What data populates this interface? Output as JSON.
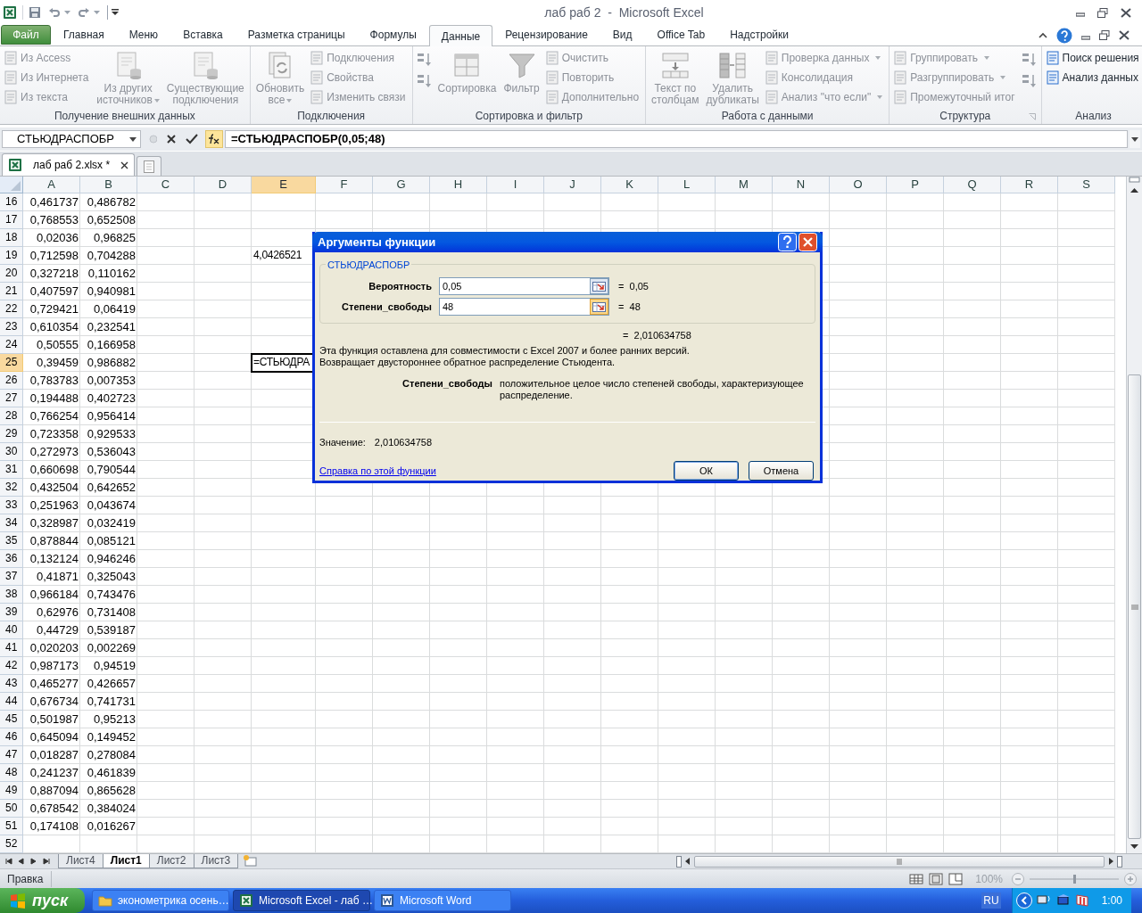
{
  "title_bar": {
    "title": "лаб раб 2  -  Microsoft Excel"
  },
  "file_tab": "Файл",
  "ribbon_tabs": [
    {
      "label": "Главная",
      "selected": false
    },
    {
      "label": "Меню",
      "selected": false
    },
    {
      "label": "Вставка",
      "selected": false
    },
    {
      "label": "Разметка страницы",
      "selected": false
    },
    {
      "label": "Формулы",
      "selected": false
    },
    {
      "label": "Данные",
      "selected": true
    },
    {
      "label": "Рецензирование",
      "selected": false
    },
    {
      "label": "Вид",
      "selected": false
    },
    {
      "label": "Office Tab",
      "selected": false
    },
    {
      "label": "Надстройки",
      "selected": false
    }
  ],
  "ribbon_groups": [
    {
      "label": "Получение внешних данных",
      "columns": [
        {
          "kind": "stack",
          "items": [
            {
              "label": "Из Access",
              "disabled": true,
              "dropdown": false
            },
            {
              "label": "Из Интернета",
              "disabled": true,
              "dropdown": false
            },
            {
              "label": "Из текста",
              "disabled": true,
              "dropdown": false
            }
          ]
        },
        {
          "kind": "large",
          "items": [
            {
              "lines": [
                "Из других",
                "источников"
              ],
              "disabled": true,
              "dropdown": true
            }
          ]
        },
        {
          "kind": "large",
          "items": [
            {
              "lines": [
                "Существующие",
                "подключения"
              ],
              "disabled": true,
              "dropdown": false
            }
          ]
        }
      ]
    },
    {
      "label": "Подключения",
      "columns": [
        {
          "kind": "large",
          "items": [
            {
              "lines": [
                "Обновить",
                "все"
              ],
              "disabled": true,
              "dropdown": true
            }
          ]
        },
        {
          "kind": "stack",
          "items": [
            {
              "label": "Подключения",
              "disabled": true,
              "dropdown": false
            },
            {
              "label": "Свойства",
              "disabled": true,
              "dropdown": false
            },
            {
              "label": "Изменить связи",
              "disabled": true,
              "dropdown": false
            }
          ]
        }
      ]
    },
    {
      "label": "Сортировка и фильтр",
      "columns": [
        {
          "kind": "icons",
          "items": [
            {
              "disabled": true
            },
            {
              "disabled": true
            }
          ]
        },
        {
          "kind": "large",
          "items": [
            {
              "lines": [
                "Сортировка"
              ],
              "disabled": true,
              "dropdown": false
            }
          ]
        },
        {
          "kind": "large",
          "items": [
            {
              "lines": [
                "Фильтр"
              ],
              "disabled": true,
              "dropdown": false
            }
          ]
        },
        {
          "kind": "stack",
          "items": [
            {
              "label": "Очистить",
              "disabled": true,
              "dropdown": false
            },
            {
              "label": "Повторить",
              "disabled": true,
              "dropdown": false
            },
            {
              "label": "Дополнительно",
              "disabled": true,
              "dropdown": false
            }
          ]
        }
      ]
    },
    {
      "label": "Работа с данными",
      "columns": [
        {
          "kind": "large",
          "items": [
            {
              "lines": [
                "Текст по",
                "столбцам"
              ],
              "disabled": true,
              "dropdown": false
            }
          ]
        },
        {
          "kind": "large",
          "items": [
            {
              "lines": [
                "Удалить",
                "дубликаты"
              ],
              "disabled": true,
              "dropdown": false
            }
          ]
        },
        {
          "kind": "stack",
          "items": [
            {
              "label": "Проверка данных",
              "disabled": true,
              "dropdown": true
            },
            {
              "label": "Консолидация",
              "disabled": true,
              "dropdown": false
            },
            {
              "label": "Анализ \"что если\"",
              "disabled": true,
              "dropdown": true
            }
          ]
        }
      ]
    },
    {
      "label": "Структура",
      "launcher": true,
      "columns": [
        {
          "kind": "stack",
          "items": [
            {
              "label": "Группировать",
              "disabled": true,
              "dropdown": true
            },
            {
              "label": "Разгруппировать",
              "disabled": true,
              "dropdown": true
            },
            {
              "label": "Промежуточный итог",
              "disabled": true,
              "dropdown": false
            }
          ]
        },
        {
          "kind": "icons",
          "items": [
            {
              "disabled": true
            },
            {
              "disabled": true
            }
          ]
        }
      ]
    },
    {
      "label": "Анализ",
      "columns": [
        {
          "kind": "stack",
          "items": [
            {
              "label": "Поиск решения",
              "disabled": false,
              "dropdown": false
            },
            {
              "label": "Анализ данных",
              "disabled": false,
              "dropdown": false
            }
          ]
        }
      ]
    }
  ],
  "formula_bar": {
    "name_box": "СТЬЮДРАСПОБР",
    "formula": "=СТЬЮДРАСПОБР(0,05;48)"
  },
  "workbook_tab": {
    "label": "лаб раб 2.xlsx *"
  },
  "columns": [
    {
      "label": "A",
      "selected": false
    },
    {
      "label": "B",
      "selected": false
    },
    {
      "label": "C",
      "selected": false
    },
    {
      "label": "D",
      "selected": false
    },
    {
      "label": "E",
      "selected": true
    },
    {
      "label": "F",
      "selected": false
    },
    {
      "label": "G",
      "selected": false
    },
    {
      "label": "H",
      "selected": false
    },
    {
      "label": "I",
      "selected": false
    },
    {
      "label": "J",
      "selected": false
    },
    {
      "label": "K",
      "selected": false
    },
    {
      "label": "L",
      "selected": false
    },
    {
      "label": "M",
      "selected": false
    },
    {
      "label": "N",
      "selected": false
    },
    {
      "label": "O",
      "selected": false
    },
    {
      "label": "P",
      "selected": false
    },
    {
      "label": "Q",
      "selected": false
    },
    {
      "label": "R",
      "selected": false
    },
    {
      "label": "S",
      "selected": false
    }
  ],
  "rows": [
    {
      "number": "16",
      "selected": false,
      "a": "0,461737",
      "b": "0,486782"
    },
    {
      "number": "17",
      "selected": false,
      "a": "0,768553",
      "b": "0,652508"
    },
    {
      "number": "18",
      "selected": false,
      "a": "0,02036",
      "b": "0,96825"
    },
    {
      "number": "19",
      "selected": false,
      "a": "0,712598",
      "b": "0,704288",
      "e": "4,0426521"
    },
    {
      "number": "20",
      "selected": false,
      "a": "0,327218",
      "b": "0,110162"
    },
    {
      "number": "21",
      "selected": false,
      "a": "0,407597",
      "b": "0,940981"
    },
    {
      "number": "22",
      "selected": false,
      "a": "0,729421",
      "b": "0,06419"
    },
    {
      "number": "23",
      "selected": false,
      "a": "0,610354",
      "b": "0,232541"
    },
    {
      "number": "24",
      "selected": false,
      "a": "0,50555",
      "b": "0,166958"
    },
    {
      "number": "25",
      "selected": true,
      "a": "0,39459",
      "b": "0,986882",
      "e": "=СТЬЮДРА"
    },
    {
      "number": "26",
      "selected": false,
      "a": "0,783783",
      "b": "0,007353"
    },
    {
      "number": "27",
      "selected": false,
      "a": "0,194488",
      "b": "0,402723"
    },
    {
      "number": "28",
      "selected": false,
      "a": "0,766254",
      "b": "0,956414"
    },
    {
      "number": "29",
      "selected": false,
      "a": "0,723358",
      "b": "0,929533"
    },
    {
      "number": "30",
      "selected": false,
      "a": "0,272973",
      "b": "0,536043"
    },
    {
      "number": "31",
      "selected": false,
      "a": "0,660698",
      "b": "0,790544"
    },
    {
      "number": "32",
      "selected": false,
      "a": "0,432504",
      "b": "0,642652"
    },
    {
      "number": "33",
      "selected": false,
      "a": "0,251963",
      "b": "0,043674"
    },
    {
      "number": "34",
      "selected": false,
      "a": "0,328987",
      "b": "0,032419"
    },
    {
      "number": "35",
      "selected": false,
      "a": "0,878844",
      "b": "0,085121"
    },
    {
      "number": "36",
      "selected": false,
      "a": "0,132124",
      "b": "0,946246"
    },
    {
      "number": "37",
      "selected": false,
      "a": "0,41871",
      "b": "0,325043"
    },
    {
      "number": "38",
      "selected": false,
      "a": "0,966184",
      "b": "0,743476"
    },
    {
      "number": "39",
      "selected": false,
      "a": "0,62976",
      "b": "0,731408"
    },
    {
      "number": "40",
      "selected": false,
      "a": "0,44729",
      "b": "0,539187"
    },
    {
      "number": "41",
      "selected": false,
      "a": "0,020203",
      "b": "0,002269"
    },
    {
      "number": "42",
      "selected": false,
      "a": "0,987173",
      "b": "0,94519"
    },
    {
      "number": "43",
      "selected": false,
      "a": "0,465277",
      "b": "0,426657"
    },
    {
      "number": "44",
      "selected": false,
      "a": "0,676734",
      "b": "0,741731"
    },
    {
      "number": "45",
      "selected": false,
      "a": "0,501987",
      "b": "0,95213"
    },
    {
      "number": "46",
      "selected": false,
      "a": "0,645094",
      "b": "0,149452"
    },
    {
      "number": "47",
      "selected": false,
      "a": "0,018287",
      "b": "0,278084"
    },
    {
      "number": "48",
      "selected": false,
      "a": "0,241237",
      "b": "0,461839"
    },
    {
      "number": "49",
      "selected": false,
      "a": "0,887094",
      "b": "0,865628"
    },
    {
      "number": "50",
      "selected": false,
      "a": "0,678542",
      "b": "0,384024"
    },
    {
      "number": "51",
      "selected": false,
      "a": "0,174108",
      "b": "0,016267"
    },
    {
      "number": "52",
      "selected": false
    }
  ],
  "sheet_tabs": [
    {
      "label": "Лист4",
      "selected": false
    },
    {
      "label": "Лист1",
      "selected": true
    },
    {
      "label": "Лист2",
      "selected": false
    },
    {
      "label": "Лист3",
      "selected": false
    }
  ],
  "status_bar": {
    "mode": "Правка",
    "zoom": "100%",
    "zoom_slider": {
      "level": 0.5
    }
  },
  "dialog": {
    "title": "Аргументы функции",
    "function_name": "СТЬЮДРАСПОБР",
    "arguments": [
      {
        "label": "Вероятность",
        "value": "0,05",
        "result": "=  0,05",
        "focused": false
      },
      {
        "label": "Степени_свободы",
        "value": "48",
        "result": "=  48",
        "focused": true
      }
    ],
    "result": "=  2,010634758",
    "description": [
      "Эта функция оставлена для совместимости с Excel 2007 и более ранних версий.",
      "Возвращает двустороннее обратное распределение Стьюдента."
    ],
    "argument_help": {
      "label": "Степени_свободы",
      "text": "положительное целое число степеней свободы, характеризующее распределение."
    },
    "value_label": "Значение:",
    "value": "2,010634758",
    "help_link": "Справка по этой функции",
    "ok": "ОК",
    "cancel": "Отмена"
  },
  "taskbar": {
    "start": "пуск",
    "tasks": [
      {
        "label": "эконометрика осень…",
        "kind": "folder",
        "selected": false
      },
      {
        "label": "Microsoft Excel - лаб …",
        "kind": "excel",
        "selected": true
      },
      {
        "label": "Microsoft Word",
        "kind": "word",
        "selected": false
      }
    ],
    "language": "RU",
    "clock": "1:00"
  }
}
